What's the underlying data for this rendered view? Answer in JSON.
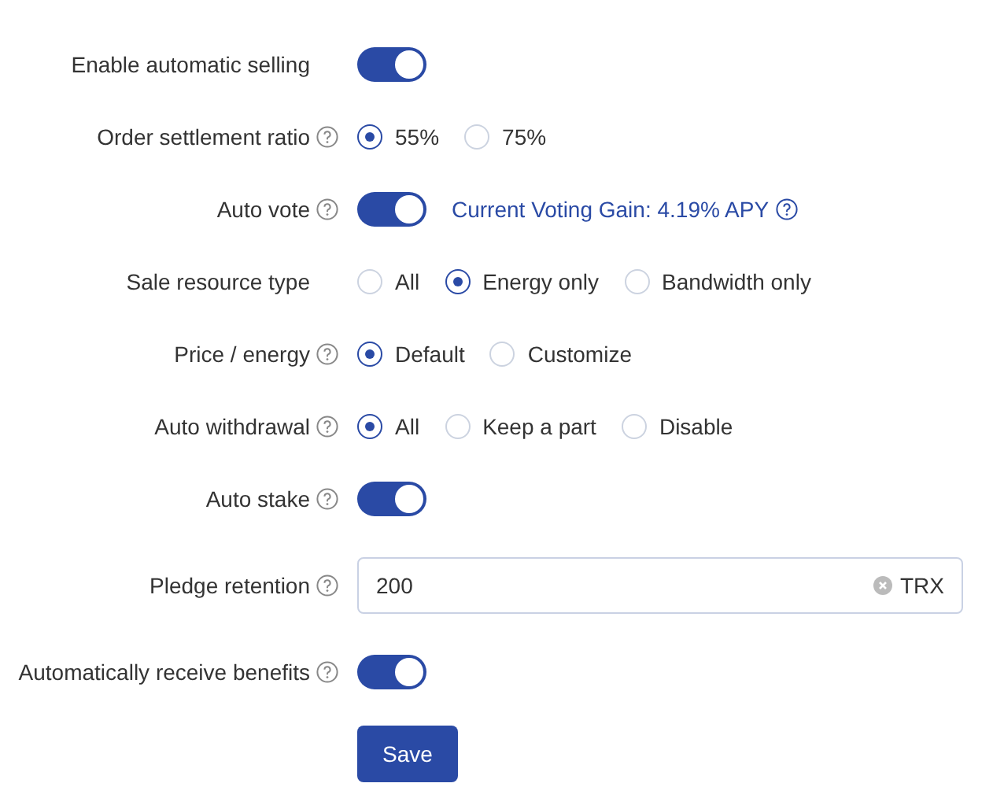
{
  "rows": [
    {
      "kind": "toggle",
      "label": "Enable automatic selling",
      "help": false,
      "on": true
    },
    {
      "kind": "radio",
      "label": "Order settlement ratio",
      "help": true,
      "options": [
        {
          "label": "55%",
          "selected": true
        },
        {
          "label": "75%",
          "selected": false
        }
      ]
    },
    {
      "kind": "toggle",
      "label": "Auto vote",
      "help": true,
      "on": true,
      "note": "Current Voting Gain: 4.19% APY"
    },
    {
      "kind": "radio",
      "label": "Sale resource type",
      "help": false,
      "options": [
        {
          "label": "All",
          "selected": false
        },
        {
          "label": "Energy only",
          "selected": true
        },
        {
          "label": "Bandwidth only",
          "selected": false
        }
      ]
    },
    {
      "kind": "radio",
      "label": "Price / energy",
      "help": true,
      "options": [
        {
          "label": "Default",
          "selected": true
        },
        {
          "label": "Customize",
          "selected": false
        }
      ]
    },
    {
      "kind": "radio",
      "label": "Auto withdrawal",
      "help": true,
      "options": [
        {
          "label": "All",
          "selected": true
        },
        {
          "label": "Keep a part",
          "selected": false
        },
        {
          "label": "Disable",
          "selected": false
        }
      ]
    },
    {
      "kind": "toggle",
      "label": "Auto stake",
      "help": true,
      "on": true
    },
    {
      "kind": "input",
      "label": "Pledge retention",
      "help": true,
      "value": "200",
      "unit": "TRX"
    },
    {
      "kind": "toggle",
      "label": "Automatically receive benefits",
      "help": true,
      "on": true
    }
  ],
  "save_button": "Save"
}
